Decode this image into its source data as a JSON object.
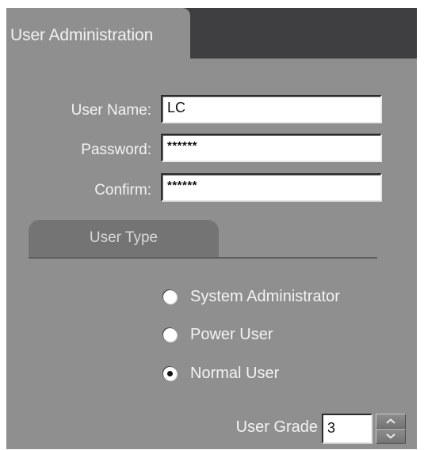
{
  "window": {
    "title": "User Administration"
  },
  "form": {
    "username_label": "User Name:",
    "username_value": "LC",
    "password_label": "Password:",
    "password_value": "******",
    "confirm_label": "Confirm:",
    "confirm_value": "******"
  },
  "user_type": {
    "tab_label": "User Type",
    "options": [
      {
        "label": "System Administrator",
        "selected": false
      },
      {
        "label": "Power User",
        "selected": false
      },
      {
        "label": "Normal User",
        "selected": true
      }
    ]
  },
  "grade": {
    "label": "User Grade",
    "value": "3"
  },
  "colors": {
    "panel": "#8f8f8f",
    "title_bar": "#3f3f42",
    "tab": "#747474",
    "text_light": "#f3f3f3"
  },
  "icons": {
    "spinner_up": "chevron-up-icon",
    "spinner_down": "chevron-down-icon"
  }
}
